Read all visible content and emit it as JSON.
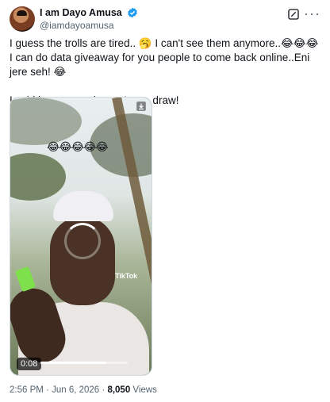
{
  "author": {
    "display_name": "I am Dayo Amusa",
    "handle": "@iamdayoamusa",
    "verified": true
  },
  "tweet": {
    "text": "I guess the trolls are tired.. 🥱 I can't see them anymore..😂😂😂 I can do data giveaway for you people to come back online..Eni jere seh! 😂\n\nI said it, you people won't see draw!"
  },
  "video": {
    "overlay_emojis": "😂😂😂😂😂",
    "watermark": "TikTok",
    "duration": "0:08",
    "progress_fraction": 0.75
  },
  "meta": {
    "time": "2:56 PM",
    "date": "Jun 6, 2026",
    "separator": "·",
    "views_count": "8,050",
    "views_label": "Views"
  },
  "colors": {
    "verified_blue": "#1d9bf0",
    "secondary_text": "#536471"
  },
  "icons": [
    "verified-badge-icon",
    "grok-icon",
    "more-options-icon",
    "download-icon",
    "loading-spinner-icon"
  ]
}
